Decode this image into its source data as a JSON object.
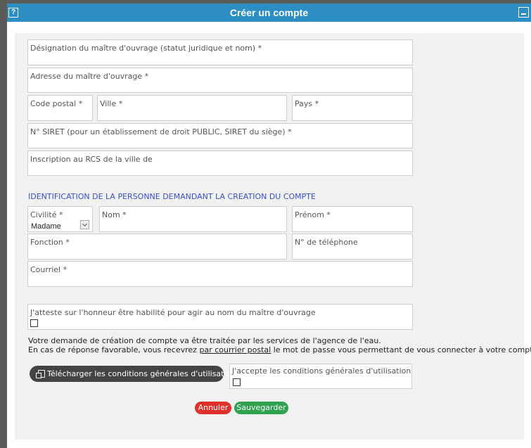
{
  "window": {
    "title": "Créer un compte",
    "help_label": "?"
  },
  "company": {
    "designation": "Désignation du maître d'ouvrage (statut juridique et nom) *",
    "address": "Adresse du maître d'ouvrage *",
    "postal_code": "Code postal *",
    "city": "Ville *",
    "country": "Pays *",
    "siret": "N° SIRET (pour un établissement de droit PUBLIC, SIRET du siège) *",
    "rcs": "Inscription au RCS de la ville de"
  },
  "person": {
    "section_title": "IDENTIFICATION DE LA PERSONNE DEMANDANT LA CREATION DU COMPTE",
    "civility_label": "Civilité *",
    "civility_value": "Madame",
    "last_name": "Nom *",
    "first_name": "Prénom *",
    "function": "Fonction *",
    "phone": "N° de téléphone",
    "email": "Courriel *"
  },
  "attestation": {
    "label": "J'atteste sur l'honneur être habilité pour agir au nom du maître d'ouvrage",
    "checked": false
  },
  "info": {
    "line1": "Votre demande de création de compte va être traitée par les services de l'agence de l'eau.",
    "line2_start": "En cas de réponse favorable, vous recevrez ",
    "line2_link": "par courrier postal",
    "line2_end": " le mot de passe vous permettant de vous connecter à votre compte."
  },
  "conditions": {
    "download_label": "Télécharger les conditions générales d'utilisation",
    "accept_label": "J'accepte les conditions générales d'utilisation",
    "accepted": false
  },
  "actions": {
    "cancel_label": "Annuler",
    "save_label": "Sauvegarder"
  },
  "colors": {
    "titlebar": "#2c8ec3",
    "section_title": "#3a4fc4",
    "cancel": "#e0302b",
    "save": "#2fa24f"
  }
}
